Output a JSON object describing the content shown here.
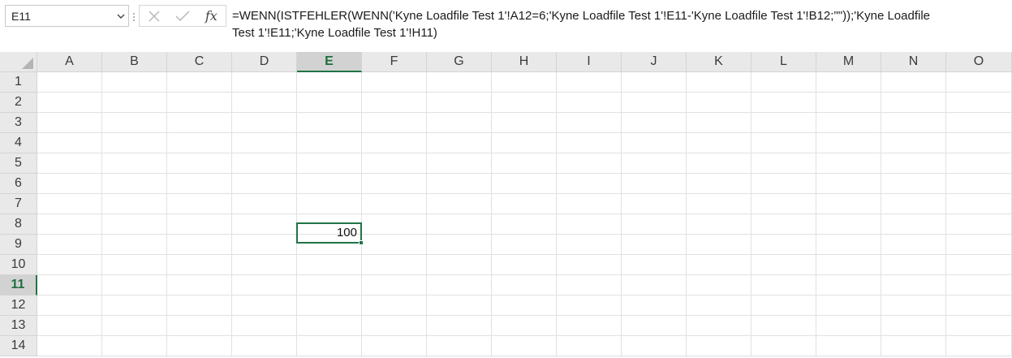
{
  "name_box": {
    "value": "E11"
  },
  "formula_bar": {
    "fx_label": "fx",
    "formula_line_1": "=WENN(ISTFEHLER(WENN('Kyne Loadfile Test 1'!A12=6;'Kyne Loadfile Test 1'!E11-'Kyne Loadfile Test 1'!B12;\"\"));'Kyne Loadfile",
    "formula_line_2": "Test 1'!E11;'Kyne Loadfile Test 1'!H11)"
  },
  "grid": {
    "columns": [
      "A",
      "B",
      "C",
      "D",
      "E",
      "F",
      "G",
      "H",
      "I",
      "J",
      "K",
      "L",
      "M",
      "N",
      "O"
    ],
    "rows": [
      "1",
      "2",
      "3",
      "4",
      "5",
      "6",
      "7",
      "8",
      "9",
      "10",
      "11",
      "12",
      "13",
      "14"
    ],
    "active_column": "E",
    "active_row": "11",
    "active_cell_value": "100"
  },
  "colors": {
    "accent": "#217346",
    "header_bg": "#e9e9e9",
    "header_active_bg": "#d2d2d2",
    "gridline": "#e1e1e1"
  },
  "icons": {
    "name_box_dropdown": "chevron-down-icon",
    "cancel": "close-icon",
    "enter": "checkmark-icon",
    "insert_function": "function-icon",
    "select_all": "select-all-triangle-icon"
  }
}
